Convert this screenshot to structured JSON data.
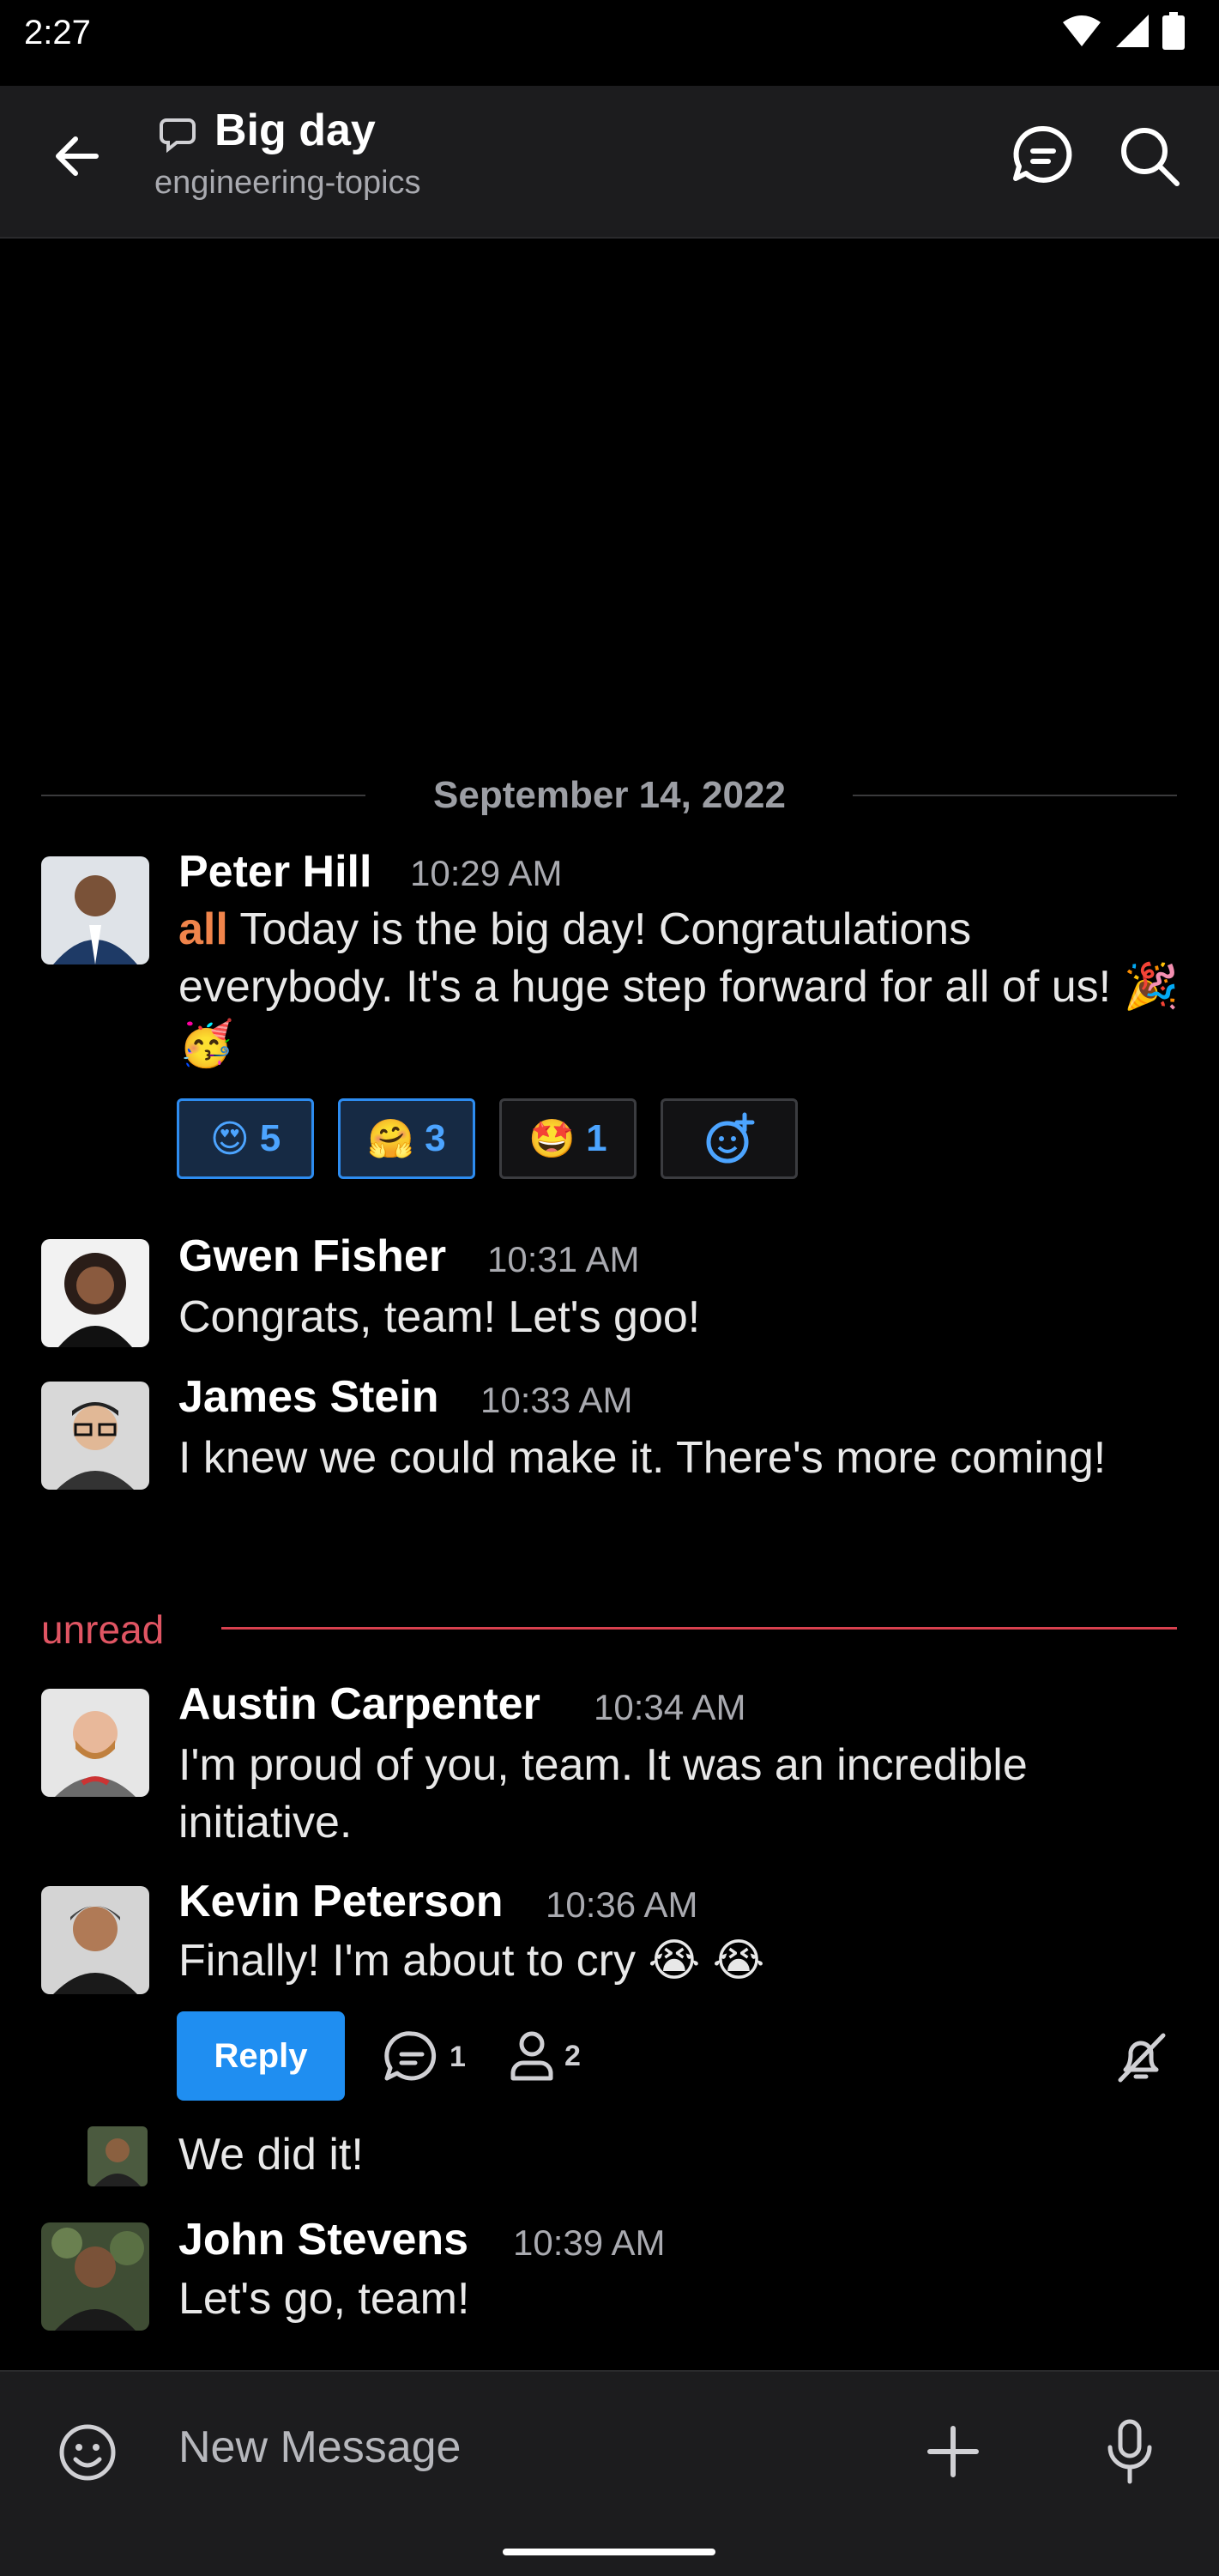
{
  "status_bar": {
    "time": "2:27"
  },
  "header": {
    "title": "Big day",
    "subtitle": "engineering-topics"
  },
  "date_divider": "September 14, 2022",
  "messages": [
    {
      "author": "Peter Hill",
      "time": "10:29 AM",
      "mention": "all",
      "text": " Today is the big day! Congratulations everybody. It's a huge step forward for all of us! 🎉 🥳"
    },
    {
      "author": "Gwen Fisher",
      "time": "10:31 AM",
      "text": "Congrats, team! Let's goo!"
    },
    {
      "author": "James Stein",
      "time": "10:33 AM",
      "text": "I knew we could make it. There's more coming!"
    },
    {
      "author": "Austin Carpenter",
      "time": "10:34 AM",
      "text": "I'm proud of you, team. It was an incredible initiative."
    },
    {
      "author": "Kevin Peterson",
      "time": "10:36 AM",
      "text": "Finally! I'm about to cry 😭 😭"
    },
    {
      "author": "",
      "time": "",
      "text": "We did it!"
    },
    {
      "author": "John Stevens",
      "time": "10:39 AM",
      "text": "Let's go, team!"
    }
  ],
  "reactions": [
    {
      "emoji": "😍",
      "count": "5",
      "active": true
    },
    {
      "emoji": "🤗",
      "count": "3",
      "active": true
    },
    {
      "emoji": "🤩",
      "count": "1",
      "active": false
    }
  ],
  "unread_label": "unread",
  "thread_footer": {
    "reply_label": "Reply",
    "replies_count": "1",
    "participants_count": "2"
  },
  "composer": {
    "placeholder": "New Message"
  },
  "colors": {
    "accent": "#1f8ef1",
    "mention": "#f0844b",
    "unread": "#d8414f"
  }
}
